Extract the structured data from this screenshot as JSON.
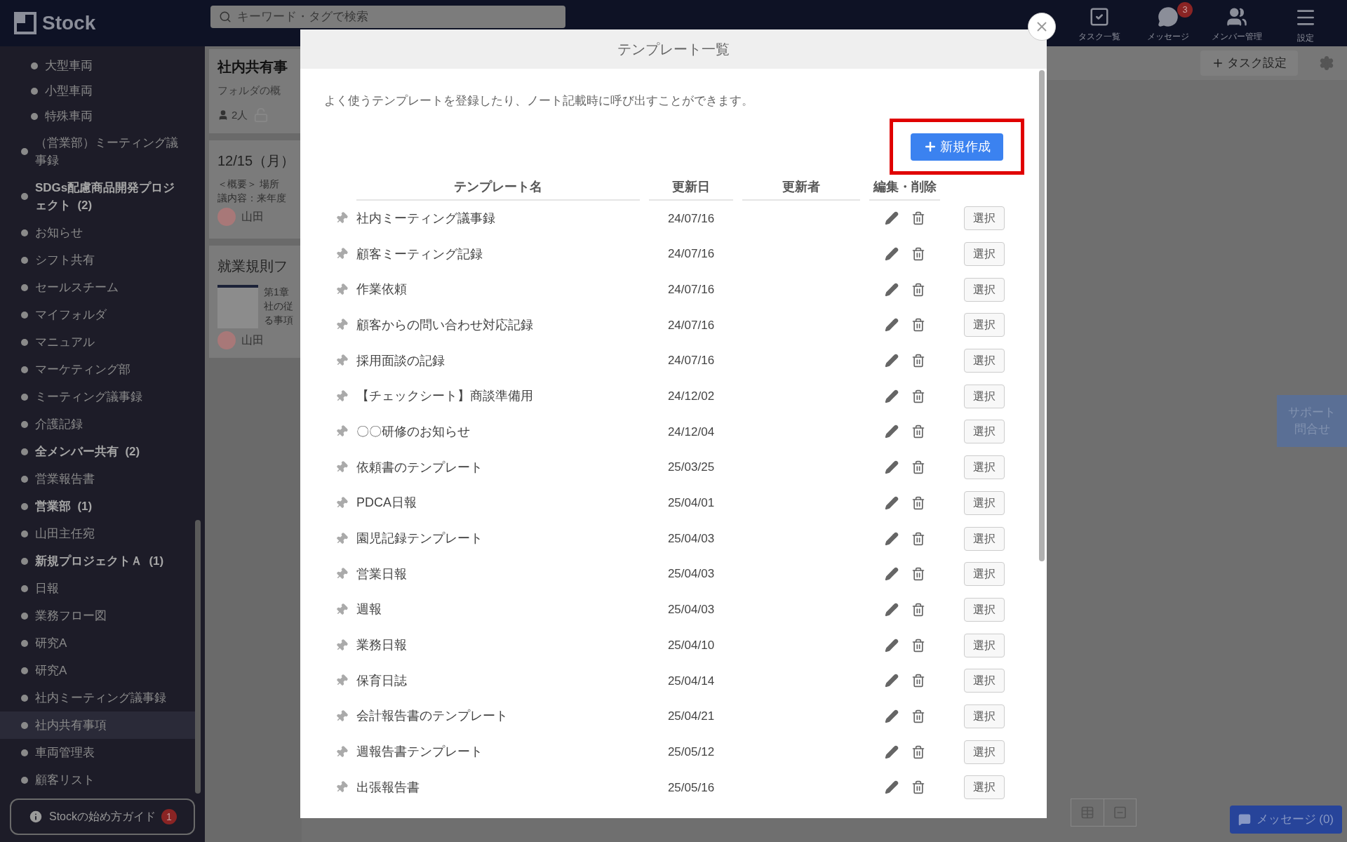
{
  "topbar": {
    "logo": "Stock",
    "search": {
      "placeholder": "キーワード・タグで検索"
    },
    "nav": [
      {
        "kind": "tasks",
        "label": "タスク一覧"
      },
      {
        "kind": "messages",
        "label": "メッセージ",
        "badge": "3"
      },
      {
        "kind": "members",
        "label": "メンバー管理"
      },
      {
        "kind": "settings",
        "label": "設定"
      }
    ]
  },
  "sidebar": {
    "sub_items": [
      {
        "label": "大型車両"
      },
      {
        "label": "小型車両"
      },
      {
        "label": "特殊車両"
      }
    ],
    "items": [
      {
        "label": "（営業部）ミーティング議事録",
        "unread": false,
        "selected": false
      },
      {
        "label": "SDGs配慮商品開発プロジェクト",
        "count": "(2)",
        "unread": true,
        "selected": false
      },
      {
        "label": "お知らせ",
        "unread": false,
        "selected": false
      },
      {
        "label": "シフト共有",
        "unread": false,
        "selected": false
      },
      {
        "label": "セールスチーム",
        "unread": false,
        "selected": false
      },
      {
        "label": "マイフォルダ",
        "unread": false,
        "selected": false
      },
      {
        "label": "マニュアル",
        "unread": false,
        "selected": false
      },
      {
        "label": "マーケティング部",
        "unread": false,
        "selected": false
      },
      {
        "label": "ミーティング議事録",
        "unread": false,
        "selected": false
      },
      {
        "label": "介護記録",
        "unread": false,
        "selected": false
      },
      {
        "label": "全メンバー共有",
        "count": "(2)",
        "unread": true,
        "selected": false
      },
      {
        "label": "営業報告書",
        "unread": false,
        "selected": false
      },
      {
        "label": "営業部",
        "count": "(1)",
        "unread": true,
        "selected": false
      },
      {
        "label": "山田主任宛",
        "unread": false,
        "selected": false
      },
      {
        "label": "新規プロジェクトＡ",
        "count": "(1)",
        "unread": true,
        "selected": false
      },
      {
        "label": "日報",
        "unread": false,
        "selected": false
      },
      {
        "label": "業務フロー図",
        "unread": false,
        "selected": false
      },
      {
        "label": "研究A",
        "unread": false,
        "selected": false
      },
      {
        "label": "研究A",
        "unread": false,
        "selected": false
      },
      {
        "label": "社内ミーティング議事録",
        "unread": false,
        "selected": false
      },
      {
        "label": "社内共有事項",
        "unread": false,
        "selected": true
      },
      {
        "label": "車両管理表",
        "unread": false,
        "selected": false
      },
      {
        "label": "顧客リスト",
        "unread": false,
        "selected": false
      }
    ],
    "guide": {
      "label": "Stockの始め方ガイド",
      "badge": "1"
    }
  },
  "cards": [
    {
      "kind": "folder",
      "title": "社内共有事",
      "text": "フォルダの概",
      "members": "2人"
    },
    {
      "kind": "note",
      "title": "12/15（月）",
      "lines": [
        "＜概要＞ 場所",
        "議内容：来年度"
      ],
      "author": "山田"
    },
    {
      "kind": "file",
      "title": "就業規則フ",
      "lines": [
        "第1章",
        "社の従",
        "る事項"
      ],
      "author": "山田"
    }
  ],
  "main": {
    "task_button": "タスク設定",
    "support": "サポート問合せ",
    "message_button": "メッセージ (0)"
  },
  "modal": {
    "title": "テンプレート一覧",
    "description": "よく使うテンプレートを登録したり、ノート記載時に呼び出すことができます。",
    "new_button": "新規作成",
    "columns": [
      "テンプレート名",
      "更新日",
      "更新者",
      "編集・削除"
    ],
    "rows": [
      {
        "name": "社内ミーティング議事録",
        "date": "24/07/16",
        "select_label": "選択"
      },
      {
        "name": "顧客ミーティング記録",
        "date": "24/07/16",
        "select_label": "選択"
      },
      {
        "name": "作業依頼",
        "date": "24/07/16",
        "select_label": "選択"
      },
      {
        "name": "顧客からの問い合わせ対応記録",
        "date": "24/07/16",
        "select_label": "選択"
      },
      {
        "name": "採用面談の記録",
        "date": "24/07/16",
        "select_label": "選択"
      },
      {
        "name": "【チェックシート】商談準備用",
        "date": "24/12/02",
        "select_label": "選択"
      },
      {
        "name": "〇〇研修のお知らせ",
        "date": "24/12/04",
        "select_label": "選択"
      },
      {
        "name": "依頼書のテンプレート",
        "date": "25/03/25",
        "select_label": "選択"
      },
      {
        "name": "PDCA日報",
        "date": "25/04/01",
        "select_label": "選択"
      },
      {
        "name": "園児記録テンプレート",
        "date": "25/04/03",
        "select_label": "選択"
      },
      {
        "name": "営業日報",
        "date": "25/04/03",
        "select_label": "選択"
      },
      {
        "name": "週報",
        "date": "25/04/03",
        "select_label": "選択"
      },
      {
        "name": "業務日報",
        "date": "25/04/10",
        "select_label": "選択"
      },
      {
        "name": "保育日誌",
        "date": "25/04/14",
        "select_label": "選択"
      },
      {
        "name": "会計報告書のテンプレート",
        "date": "25/04/21",
        "select_label": "選択"
      },
      {
        "name": "週報告書テンプレート",
        "date": "25/05/12",
        "select_label": "選択"
      },
      {
        "name": "出張報告書",
        "date": "25/05/16",
        "select_label": "選択"
      }
    ]
  }
}
